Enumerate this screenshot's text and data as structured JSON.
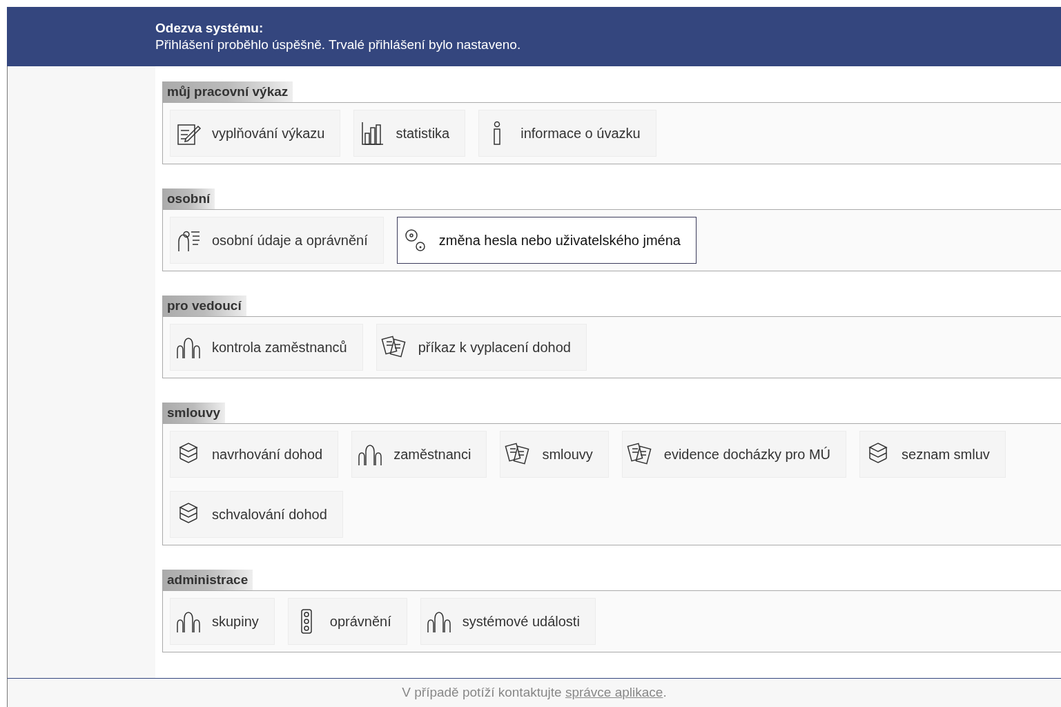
{
  "message": {
    "title": "Odezva systému:",
    "text": "Přihlášení proběhlo úspěšně. Trvalé přihlášení bylo nastaveno."
  },
  "sections": [
    {
      "title": "můj pracovní výkaz",
      "items": [
        {
          "label": "vyplňování výkazu",
          "selected": false
        },
        {
          "label": "statistika",
          "selected": false
        },
        {
          "label": "informace o úvazku",
          "selected": false
        }
      ]
    },
    {
      "title": "osobní",
      "items": [
        {
          "label": "osobní údaje a oprávnění",
          "selected": false
        },
        {
          "label": "změna hesla nebo uživatelského jména",
          "selected": true
        }
      ]
    },
    {
      "title": "pro vedoucí",
      "items": [
        {
          "label": "kontrola zaměstnanců",
          "selected": false
        },
        {
          "label": "příkaz k vyplacení dohod",
          "selected": false
        }
      ]
    },
    {
      "title": "smlouvy",
      "items": [
        {
          "label": "navrhování dohod",
          "selected": false
        },
        {
          "label": "zaměstnanci",
          "selected": false
        },
        {
          "label": "smlouvy",
          "selected": false
        },
        {
          "label": "evidence docházky pro MÚ",
          "selected": false
        },
        {
          "label": "seznam smluv",
          "selected": false
        },
        {
          "label": "schvalování dohod",
          "selected": false
        }
      ]
    },
    {
      "title": "administrace",
      "items": [
        {
          "label": "skupiny",
          "selected": false
        },
        {
          "label": "oprávnění",
          "selected": false
        },
        {
          "label": "systémové události",
          "selected": false
        }
      ]
    }
  ],
  "footer": {
    "text": "V případě potíží kontaktujte",
    "link": "správce aplikace",
    "end": "."
  }
}
